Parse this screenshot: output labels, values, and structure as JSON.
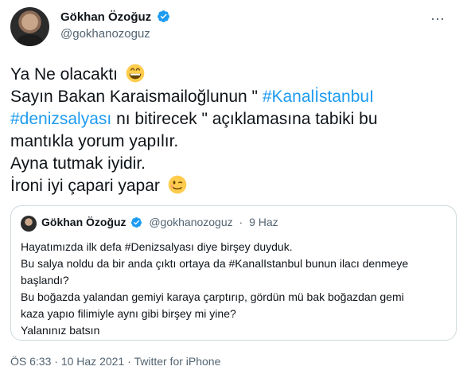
{
  "author": {
    "name": "Gökhan Özoğuz",
    "handle": "@gokhanozoguz"
  },
  "tweet": {
    "line1": "Ya Ne olacaktı",
    "line2_prefix": "Sayın Bakan Karaismailoğlunun \" ",
    "line2_hashtag": "#KanalİstanbuI",
    "line3_hashtag": "#denizsalyası",
    "line3_suffix": " nı bitirecek \" açıklamasına tabiki bu",
    "line4": "mantıkla yorum yapılır.",
    "line5": "Ayna tutmak iyidir.",
    "line6": "İroni iyi çapari yapar"
  },
  "quoted": {
    "name": "Gökhan Özoğuz",
    "handle": "@gokhanozoguz",
    "separator": "·",
    "date": "9 Haz",
    "lines": [
      "Hayatımızda ilk defa  #Denizsalyası diye birşey duyduk.",
      "Bu salya noldu da bir anda çıktı ortaya da #KanalIstanbul bunun ilacı denmeye",
      "başlandı?",
      "Bu boğazda yalandan gemiyi karaya çarptırıp, gördün mü bak boğazdan gemi",
      "kaza yapıo filimiyle aynı gibi birşey mi yine?",
      "Yalanınız batsın"
    ]
  },
  "footer": {
    "time": "ÖS 6:33",
    "separator1": " · ",
    "date": "10 Haz 2021",
    "separator2": " · ",
    "source": "Twitter for iPhone"
  },
  "icons": {
    "verified": "verified-badge-icon",
    "emoji1": "grinning-face-emoji",
    "emoji2": "winking-face-emoji",
    "more": "more-options-icon"
  },
  "colors": {
    "link": "#1d9bf0",
    "secondary_text": "#536471",
    "border": "#cfd9de"
  }
}
